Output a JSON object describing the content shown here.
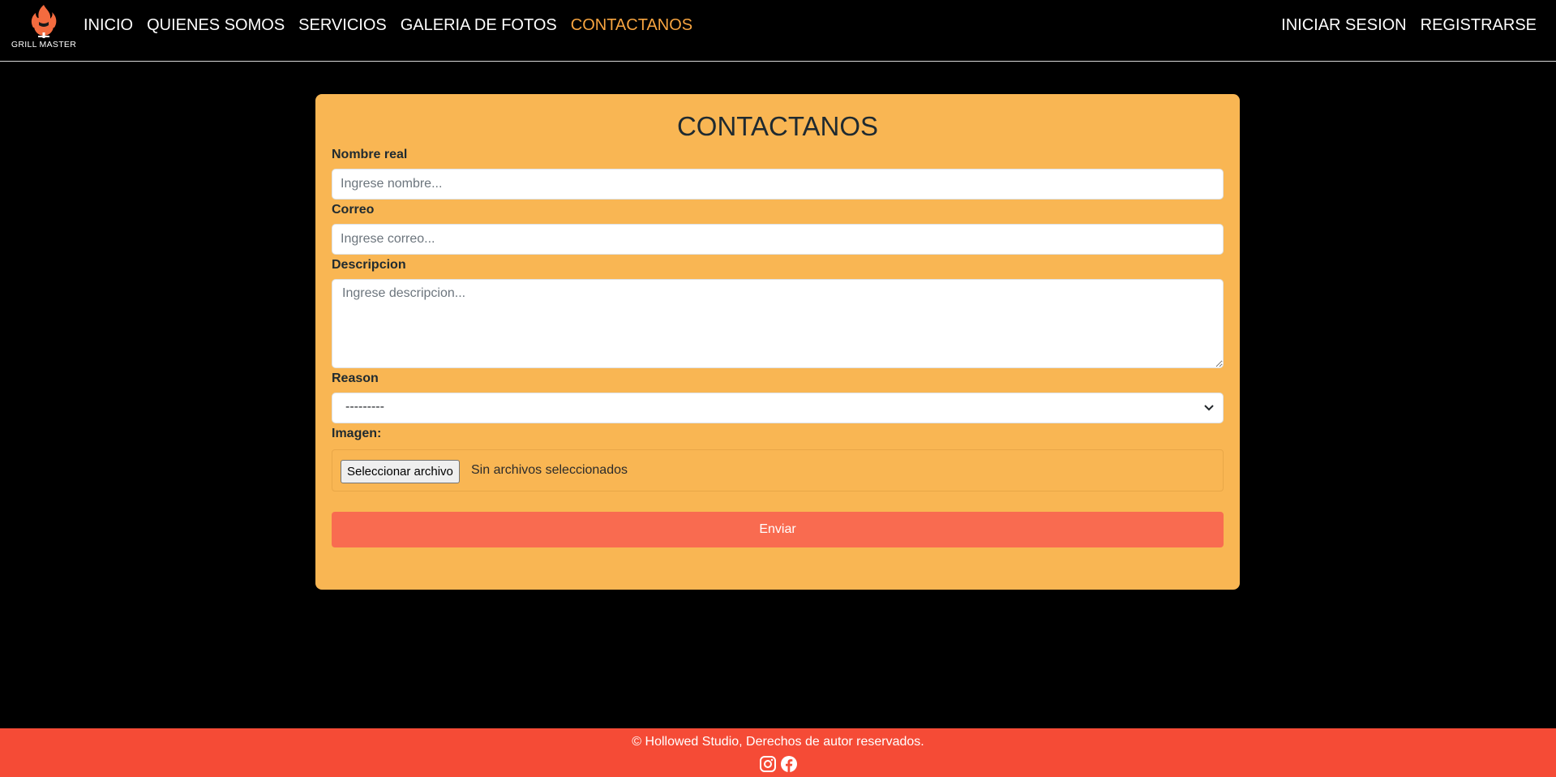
{
  "brand": {
    "name": "GRILL MASTER",
    "logo_icon": "flame-grill-icon",
    "accent_color": "#f36b3f"
  },
  "nav": {
    "left": [
      {
        "label": "INICIO",
        "active": false
      },
      {
        "label": "QUIENES SOMOS",
        "active": false
      },
      {
        "label": "SERVICIOS",
        "active": false
      },
      {
        "label": "GALERIA DE FOTOS",
        "active": false
      },
      {
        "label": "CONTACTANOS",
        "active": true
      }
    ],
    "right": [
      {
        "label": "INICIAR SESION"
      },
      {
        "label": "REGISTRARSE"
      }
    ],
    "active_color": "#f7a440"
  },
  "form": {
    "title": "CONTACTANOS",
    "name_label": "Nombre real",
    "name_placeholder": "Ingrese nombre...",
    "email_label": "Correo",
    "email_placeholder": "Ingrese correo...",
    "description_label": "Descripcion",
    "description_placeholder": "Ingrese descripcion...",
    "reason_label": "Reason",
    "reason_selected": "---------",
    "image_label": "Imagen:",
    "file_button": "Seleccionar archivo",
    "file_status": "Sin archivos seleccionados",
    "submit_label": "Enviar",
    "card_color": "#f9b653",
    "submit_color": "#f96b50"
  },
  "footer": {
    "copyright": "© Hollowed Studio, Derechos de autor reservados.",
    "icons": [
      "instagram-icon",
      "facebook-icon"
    ],
    "color": "#f54b36"
  }
}
